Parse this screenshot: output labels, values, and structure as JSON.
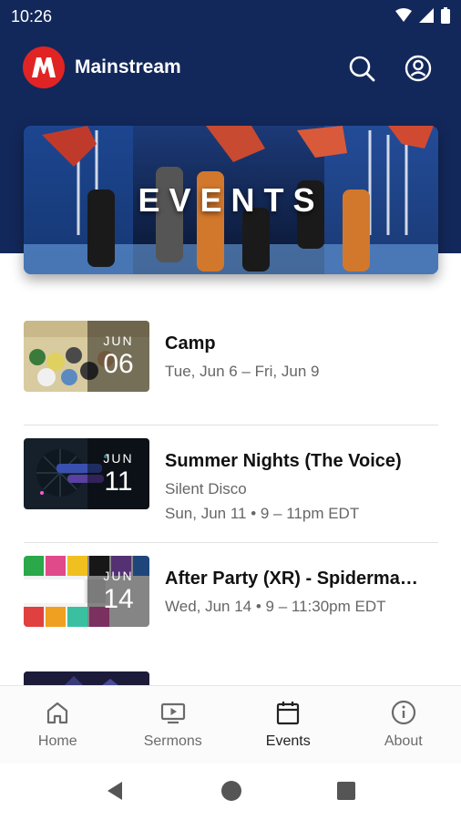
{
  "status_bar": {
    "time": "10:26"
  },
  "app": {
    "title": "Mainstream"
  },
  "banner": {
    "title": "EVENTS"
  },
  "events": [
    {
      "title": "Camp",
      "month": "JUN",
      "day": "06",
      "lines": [
        "Tue, Jun 6 – Fri, Jun 9"
      ]
    },
    {
      "title": "Summer Nights (The Voice)",
      "month": "JUN",
      "day": "11",
      "lines": [
        "Silent Disco",
        "Sun, Jun 11 • 9 – 11pm EDT"
      ]
    },
    {
      "title": "After Party (XR) - Spiderma…",
      "month": "JUN",
      "day": "14",
      "lines": [
        "Wed, Jun 14 • 9 – 11:30pm EDT"
      ]
    }
  ],
  "bottom_nav": [
    {
      "label": "Home",
      "icon": "home-icon",
      "active": false
    },
    {
      "label": "Sermons",
      "icon": "tv-icon",
      "active": false
    },
    {
      "label": "Events",
      "icon": "calendar-icon",
      "active": true
    },
    {
      "label": "About",
      "icon": "info-icon",
      "active": false
    }
  ],
  "colors": {
    "header_bg": "#13285a",
    "logo_red": "#e02424",
    "text_primary": "#111111",
    "text_secondary": "#666666"
  }
}
